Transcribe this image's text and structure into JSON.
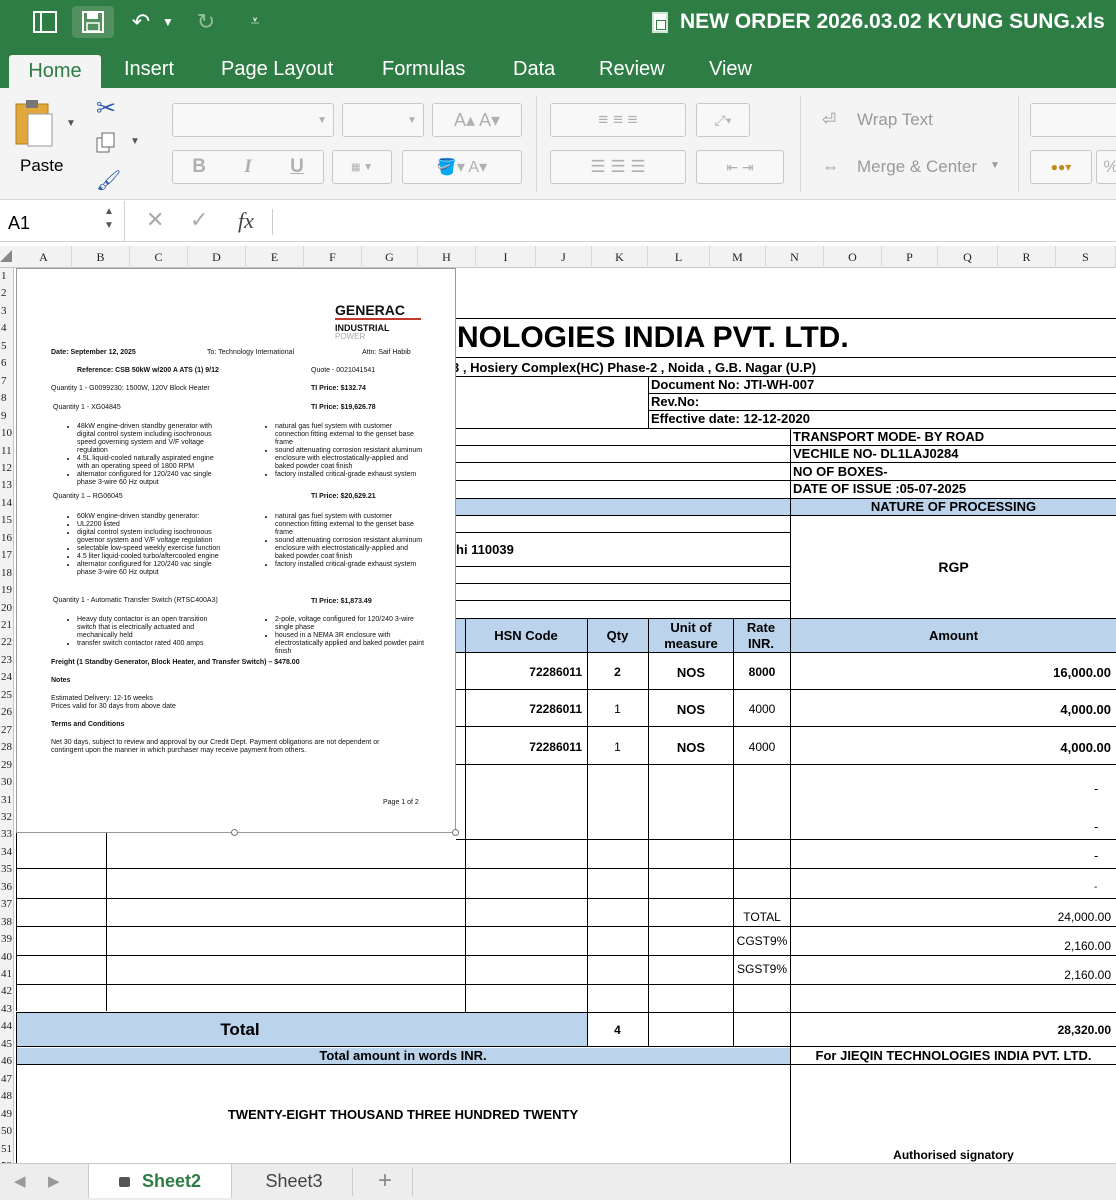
{
  "window": {
    "title": "NEW ORDER 2026.03.02 KYUNG SUNG.xls"
  },
  "ribbon_tabs": [
    "Home",
    "Insert",
    "Page Layout",
    "Formulas",
    "Data",
    "Review",
    "View"
  ],
  "ribbon": {
    "paste": "Paste",
    "wrap_text": "Wrap Text",
    "merge_center": "Merge & Center",
    "bold": "B",
    "italic": "I",
    "underline": "U"
  },
  "formula_bar": {
    "name_box": "A1",
    "fx": "fx",
    "value": ""
  },
  "columns": [
    "A",
    "B",
    "C",
    "D",
    "E",
    "F",
    "G",
    "H",
    "I",
    "J",
    "K",
    "L",
    "M",
    "N",
    "O",
    "P",
    "Q",
    "R",
    "S"
  ],
  "rows": [
    "1",
    "2",
    "3",
    "4",
    "5",
    "6",
    "7",
    "8",
    "9",
    "10",
    "11",
    "12",
    "13",
    "14",
    "15",
    "16",
    "17",
    "18",
    "19",
    "20",
    "21",
    "22",
    "23",
    "24",
    "25",
    "26",
    "27",
    "28",
    "29",
    "30",
    "31",
    "32",
    "33",
    "34",
    "35",
    "36",
    "37",
    "38",
    "39",
    "40",
    "41",
    "42",
    "43",
    "44",
    "45",
    "46",
    "47",
    "48",
    "49",
    "50",
    "51",
    "52"
  ],
  "sheet": {
    "company": "NOLOGIES INDIA PVT. LTD.",
    "address": "3 , Hosiery Complex(HC)  Phase-2  , Noida , G.B. Nagar (U.P)",
    "doc_no": "Document No:  JTI-WH-007",
    "rev_no": "Rev.No:",
    "eff_date": "Effective date:  12-12-2020",
    "transport": "TRANSPORT MODE-  BY ROAD",
    "vehicle": "VECHILE NO- DL1LAJ0284",
    "boxes": "NO OF BOXES-",
    "issue_date": "DATE  OF ISSUE :05-07-2025",
    "nature_hdr": "NATURE OF PROCESSING",
    "nature_val": "RGP",
    "delhi": "hi 110039",
    "headers": {
      "hsn": "HSN Code",
      "qty": "Qty",
      "unit": "Unit of measure",
      "rate": "Rate INR.",
      "amount": "Amount"
    },
    "items": [
      {
        "hsn": "72286011",
        "qty": "2",
        "unit": "NOS",
        "rate": "8000",
        "amount": "16,000.00"
      },
      {
        "hsn": "72286011",
        "qty": "1",
        "unit": "NOS",
        "rate": "4000",
        "amount": "4,000.00"
      },
      {
        "hsn": "72286011",
        "qty": "1",
        "unit": "NOS",
        "rate": "4000",
        "amount": "4,000.00"
      }
    ],
    "dashes": [
      "-",
      "-",
      "-",
      "-"
    ],
    "total_lbl": "TOTAL",
    "total_val": "24,000.00",
    "cgst_lbl": "CGST9%",
    "cgst_val": "2,160.00",
    "sgst_lbl": "SGST9%",
    "sgst_val": "2,160.00",
    "grand_lbl": "Total",
    "grand_qty": "4",
    "grand_val": "28,320.00",
    "words_hdr": "Total amount in words INR.",
    "for_company": "For JIEQIN TECHNOLOGIES INDIA PVT. LTD.",
    "words": "TWENTY-EIGHT THOUSAND THREE HUNDRED TWENTY",
    "signatory": "Authorised signatory"
  },
  "quote": {
    "logo_main": "GENERAC",
    "logo_sub": "INDUSTRIAL",
    "logo_sub2": "POWER",
    "date": "Date: September 12, 2025",
    "to": "To: Technology International",
    "attn": "Attn: Saif Habib",
    "reference": "Reference: CSB 50kW w/200 A ATS (1) 9/12",
    "quote_no": "Quote - 0021041541",
    "q1": "Quantity 1 - G0099230: 1500W, 120V Block Heater",
    "q1_price": "TI Price: $132.74",
    "q2": "Quantity 1 - XG04845",
    "q2_price": "TI Price: $19,626.78",
    "q2_left": [
      "48kW engine-driven standby generator with digital control system including isochronous speed governing system and V/F voltage regulation",
      "4.5L liquid-cooled naturally aspirated engine with an operating speed of 1800 RPM",
      "alternator configured for 120/240 vac single phase 3-wire 60 Hz output"
    ],
    "q2_right": [
      "natural gas fuel system with customer connection fitting external to the genset base frame",
      "sound attenuating corrosion resistant aluminum enclosure with electrostatically-applied and baked powder coat finish",
      "factory installed critical-grade exhaust system"
    ],
    "q3": "Quantity 1 – RG06045",
    "q3_price": "TI Price: $20,629.21",
    "q3_left": [
      "60kW engine-driven standby generator:",
      "UL2200 listed",
      "digital control system including isochronous governor system and V/F voltage regulation",
      "selectable low-speed weekly exercise function",
      "4.5 liter liquid-cooled turbo/aftercooled engine",
      "alternator configured for 120/240 vac single phase 3-wire 60 Hz output"
    ],
    "q3_right": [
      "natural gas fuel system with customer connection fitting external to the genset base frame",
      "sound attenuating corrosion resistant aluminum enclosure with electrostatically-applied and baked powder coat finish",
      "factory installed critical-grade exhaust system"
    ],
    "q4": "Quantity 1 - Automatic Transfer Switch (RTSC400A3)",
    "q4_price": "TI Price: $1,873.49",
    "q4_left": [
      "Heavy duty contactor is an open transition switch that is electrically actuated and mechanically held",
      "transfer switch contactor rated 400 amps"
    ],
    "q4_right": [
      "2-pole, voltage configured for 120/240 3-wire single phase",
      "housed in a NEMA 3R enclosure with electrostatically applied and baked powder paint finish"
    ],
    "freight": "Freight (1 Standby Generator, Block Heater, and Transfer Switch) – $478.00",
    "notes": "Notes",
    "delivery": "Estimated Delivery: 12-16 weeks",
    "valid": "Prices valid for 30 days from above date",
    "terms_hdr": "Terms and Conditions",
    "terms1": "Net 30 days, subject to review and approval by our Credit Dept. Payment obligations are not dependent or",
    "terms2": "contingent upon the manner in which purchaser may receive payment from others.",
    "page": "Page 1 of 2"
  },
  "sheet_tabs": [
    "Sheet2",
    "Sheet3"
  ],
  "add_sheet": "+"
}
